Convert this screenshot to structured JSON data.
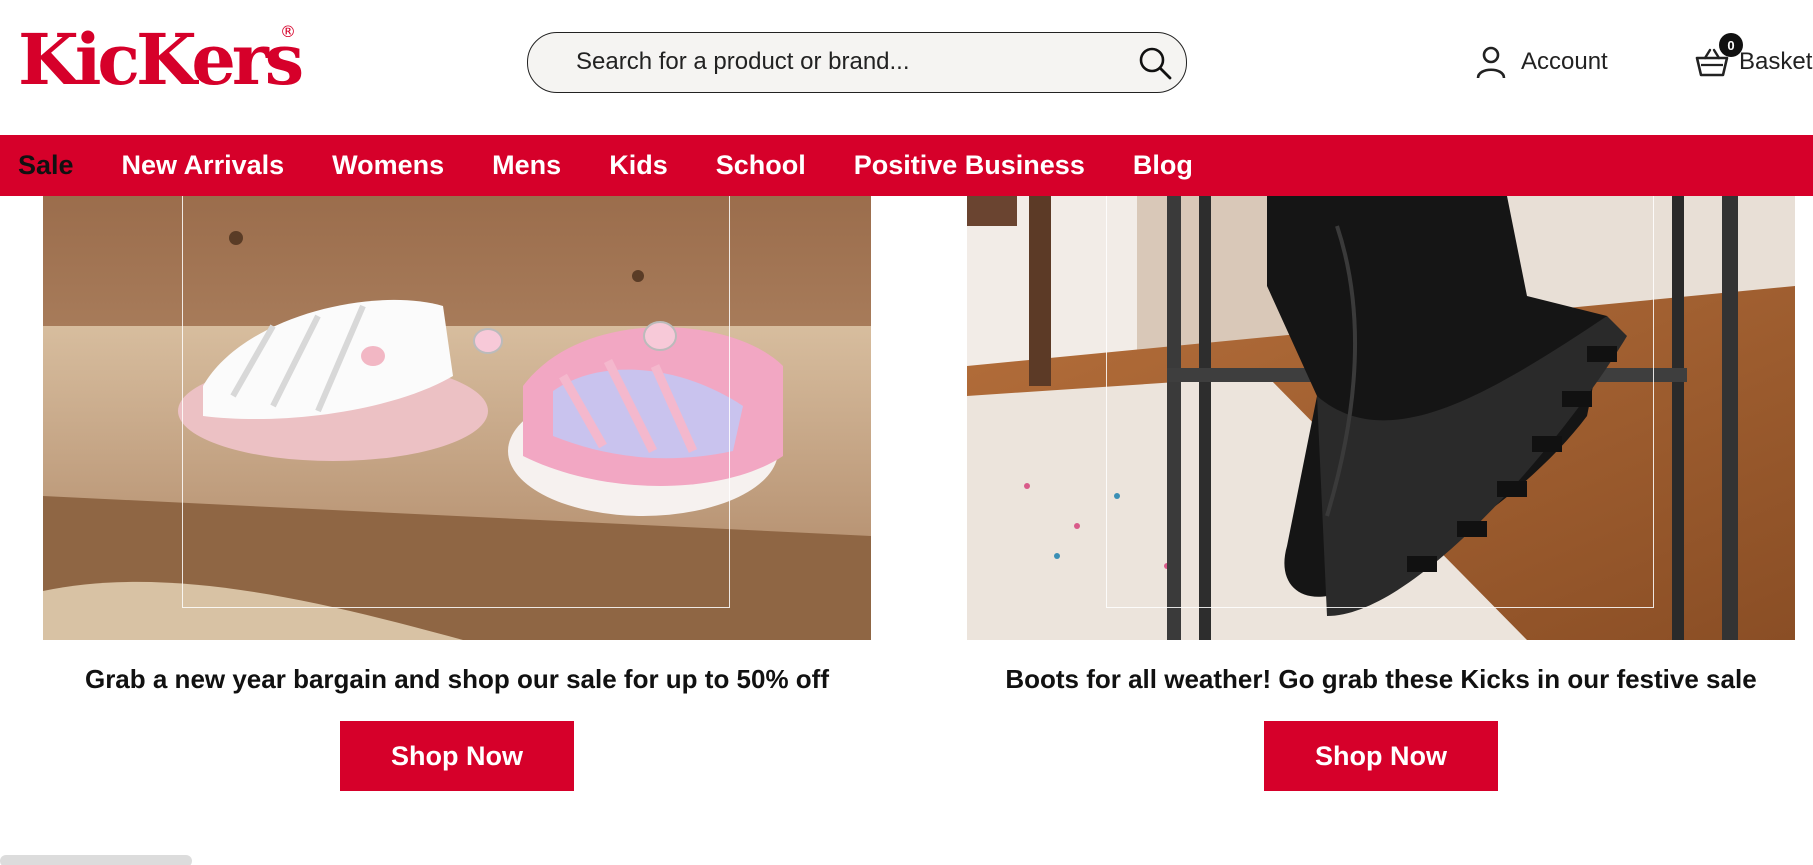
{
  "brand": {
    "name": "KicKers",
    "registered": "®"
  },
  "search": {
    "placeholder": "Search for a product or brand...",
    "value": ""
  },
  "header": {
    "account_label": "Account",
    "basket_label": "Basket",
    "basket_count": "0"
  },
  "nav": {
    "items": [
      "Sale",
      "New Arrivals",
      "Womens",
      "Mens",
      "Kids",
      "School",
      "Positive Business",
      "Blog"
    ]
  },
  "promos": [
    {
      "caption": "Grab a new year bargain and shop our sale for up to 50% off",
      "button": "Shop Now"
    },
    {
      "caption": "Boots for all weather! Go grab these Kicks in our festive sale",
      "button": "Shop Now"
    }
  ],
  "colors": {
    "brand_red": "#d6002a",
    "text": "#111111",
    "search_bg": "#f5f4f2"
  },
  "icons": {
    "search": "search-icon",
    "account": "user-icon",
    "basket": "basket-icon"
  }
}
